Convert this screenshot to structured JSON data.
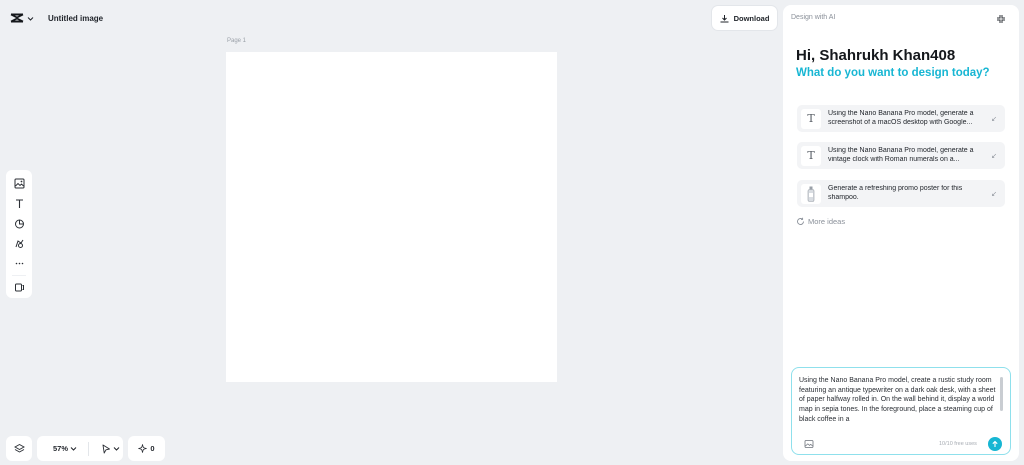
{
  "header": {
    "doc_title": "Untitled image",
    "download_label": "Download"
  },
  "canvas": {
    "page_label": "Page 1"
  },
  "bottom_bar": {
    "zoom_label": "57%",
    "credits_value": "0"
  },
  "panel": {
    "title": "Design with AI",
    "greeting": "Hi, Shahrukh Khan408",
    "subtitle": "What do you want to design today?",
    "ideas": [
      {
        "line1": "Using the Nano Banana Pro model, generate a",
        "line2": "screenshot of a macOS desktop with Google...",
        "thumb": "text-icon"
      },
      {
        "line1": "Using the Nano Banana Pro model, generate a",
        "line2": "vintage clock with Roman numerals on a...",
        "thumb": "text-icon"
      },
      {
        "line1": "Generate a refreshing promo poster for this",
        "line2": "shampoo.",
        "thumb": "shampoo-bottle-image"
      }
    ],
    "more_ideas_label": "More ideas",
    "prompt_text": "Using the Nano Banana Pro model, create a rustic study room featuring an antique typewriter on a dark oak desk, with a sheet of paper halfway rolled in. On the wall behind it, display a world map in sepia tones. In the foreground, place a steaming cup of black coffee in a",
    "free_uses_label": "10/10 free uses"
  },
  "colors": {
    "accent": "#17b6d3",
    "background": "#eef0f3",
    "panel": "#ffffff"
  }
}
